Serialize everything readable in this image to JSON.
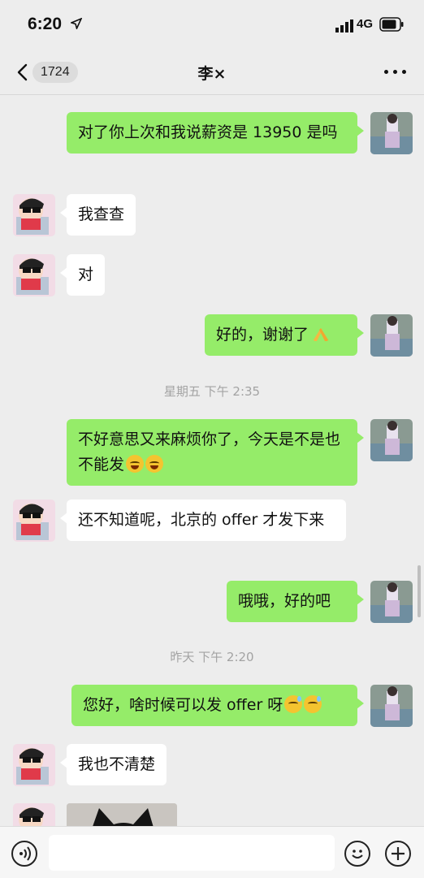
{
  "status_bar": {
    "time": "6:20",
    "network": "4G"
  },
  "nav": {
    "back_count": "1724",
    "title": "李×"
  },
  "messages": [
    {
      "from": "me",
      "text": "对了你上次和我说薪资是 13950 是吗"
    },
    {
      "from": "other",
      "text": "我查查"
    },
    {
      "from": "other",
      "text": "对"
    },
    {
      "from": "me",
      "text": "好的，谢谢了",
      "emoji": [
        "pray"
      ]
    },
    {
      "from": "time",
      "text": "星期五 下午 2:35"
    },
    {
      "from": "me",
      "text": "不好意思又来麻烦你了，今天是不是也不能发",
      "emoji": [
        "cry",
        "cry"
      ]
    },
    {
      "from": "other",
      "text": "还不知道呢，北京的 offer 才发下来"
    },
    {
      "from": "me",
      "text": "哦哦，好的吧"
    },
    {
      "from": "time",
      "text": "昨天 下午 2:20"
    },
    {
      "from": "me",
      "text": "您好，啥时候可以发 offer 呀",
      "emoji": [
        "sweat",
        "sweat"
      ]
    },
    {
      "from": "other",
      "text": "我也不清楚"
    },
    {
      "from": "other",
      "type": "image"
    }
  ],
  "colors": {
    "my_bubble": "#95ec69",
    "their_bubble": "#ffffff",
    "background": "#ededed"
  }
}
